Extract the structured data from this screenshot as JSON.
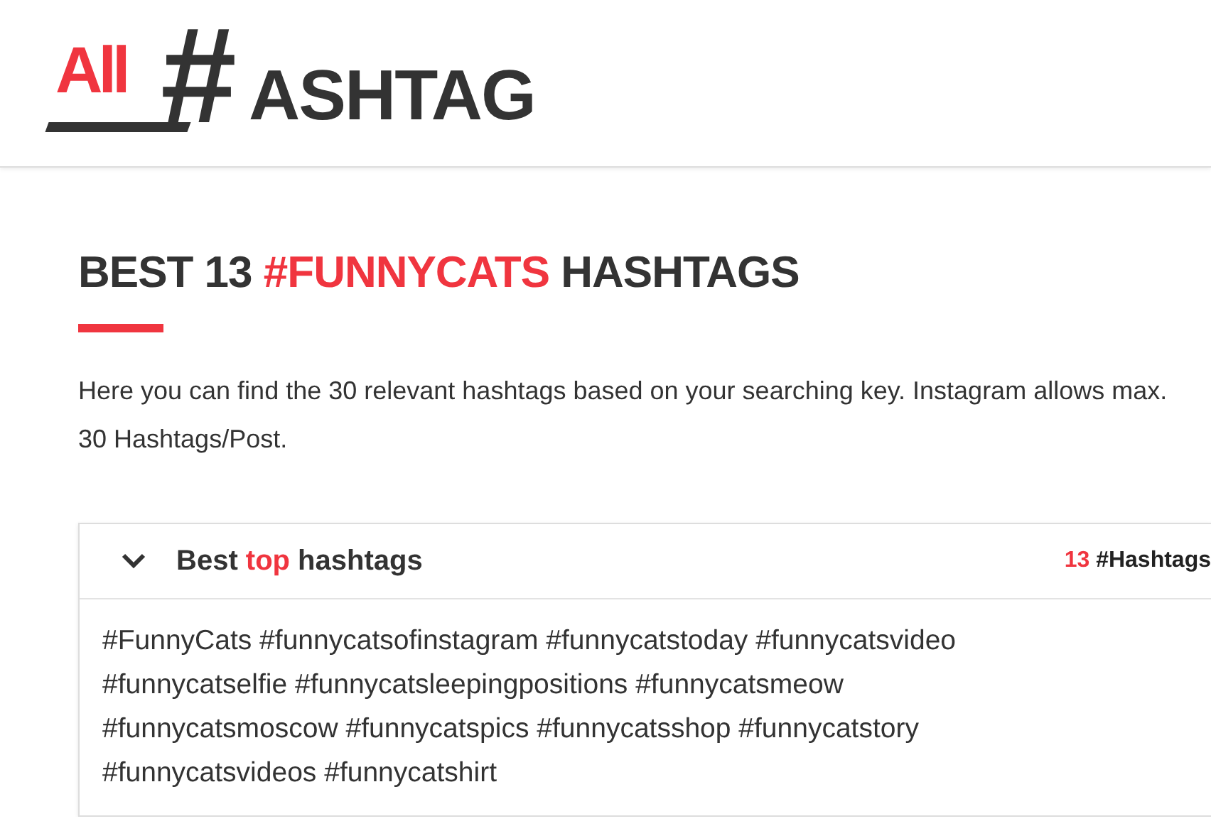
{
  "logo": {
    "prefix": "All",
    "mark": "#",
    "suffix": "ASHTAG"
  },
  "heading": {
    "parts": [
      {
        "text": "BEST 13 ",
        "highlight": false
      },
      {
        "text": "#FUNNYCATS",
        "highlight": true
      },
      {
        "text": " HASHTAGS",
        "highlight": false
      }
    ]
  },
  "intro": "Here you can find the 30 relevant hashtags based on your searching key. Instagram allows max. 30 Hashtags/Post.",
  "panel": {
    "expanded": true,
    "title_parts": [
      {
        "text": "Best ",
        "highlight": false
      },
      {
        "text": "top",
        "highlight": true
      },
      {
        "text": " hashtags",
        "highlight": false
      }
    ],
    "count": "13",
    "count_label": "#Hashtags",
    "lines": [
      "#FunnyCats #funnycatsofinstagram #funnycatstoday #funnycatsvideo",
      "#funnycatselfie #funnycatsleepingpositions #funnycatsmeow",
      "#funnycatsmoscow #funnycatspics #funnycatsshop #funnycatstory",
      "#funnycatsvideos #funnycatshirt"
    ]
  }
}
